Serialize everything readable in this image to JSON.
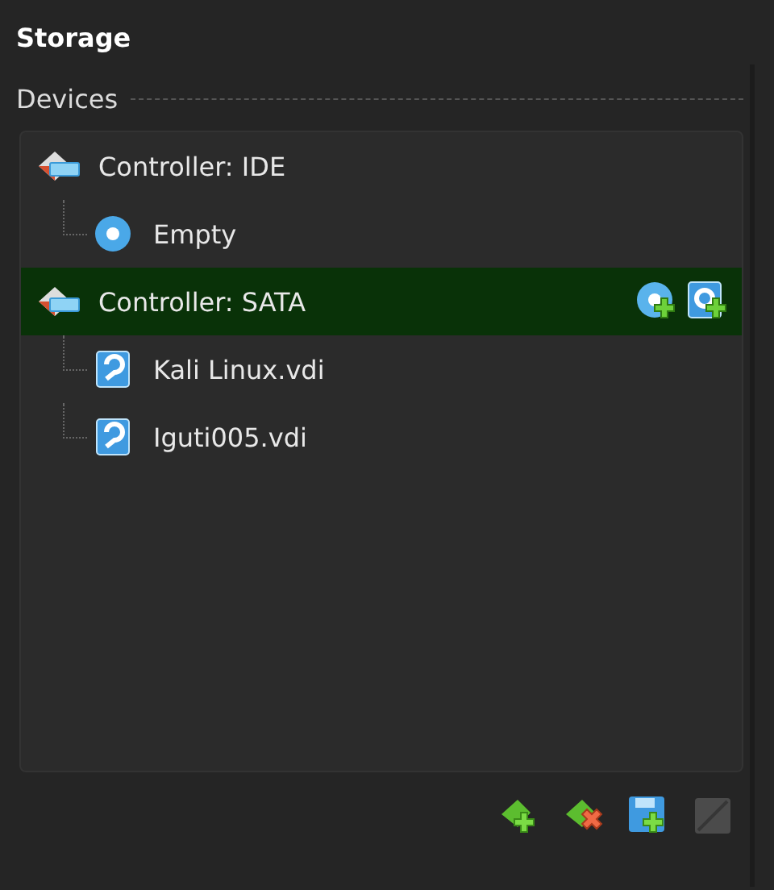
{
  "panel": {
    "title": "Storage",
    "section_label": "Devices"
  },
  "tree": [
    {
      "kind": "controller",
      "label": "Controller: IDE",
      "selected": false,
      "children": [
        {
          "kind": "optical",
          "label": "Empty",
          "selected": false
        }
      ]
    },
    {
      "kind": "controller",
      "label": "Controller: SATA",
      "selected": true,
      "actions": [
        {
          "kind": "add-optical"
        },
        {
          "kind": "add-disk"
        }
      ],
      "children": [
        {
          "kind": "disk",
          "label": "Kali Linux.vdi",
          "selected": false
        },
        {
          "kind": "disk",
          "label": "Iguti005.vdi",
          "selected": false
        }
      ]
    }
  ],
  "toolbar": [
    {
      "kind": "add-controller",
      "disabled": false
    },
    {
      "kind": "remove-controller",
      "disabled": false
    },
    {
      "kind": "add-attachment",
      "disabled": false
    },
    {
      "kind": "remove-attachment",
      "disabled": true
    }
  ]
}
